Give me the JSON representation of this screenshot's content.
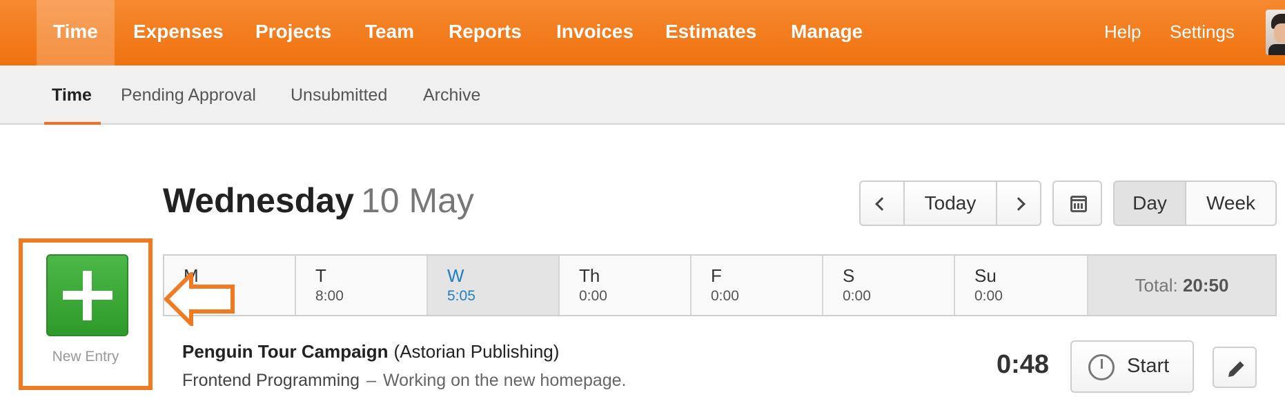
{
  "topnav": {
    "items": [
      "Time",
      "Expenses",
      "Projects",
      "Team",
      "Reports",
      "Invoices",
      "Estimates",
      "Manage"
    ],
    "right": [
      "Help",
      "Settings"
    ]
  },
  "subnav": {
    "tabs": [
      "Time",
      "Pending Approval",
      "Unsubmitted",
      "Archive"
    ]
  },
  "header": {
    "day_of_week": "Wednesday",
    "date": "10 May",
    "today_label": "Today",
    "view_day": "Day",
    "view_week": "Week"
  },
  "week": {
    "days": [
      {
        "label": "M",
        "hours": ""
      },
      {
        "label": "T",
        "hours": "8:00"
      },
      {
        "label": "W",
        "hours": "5:05"
      },
      {
        "label": "Th",
        "hours": "0:00"
      },
      {
        "label": "F",
        "hours": "0:00"
      },
      {
        "label": "S",
        "hours": "0:00"
      },
      {
        "label": "Su",
        "hours": "0:00"
      }
    ],
    "total_label": "Total:",
    "total_value": "20:50"
  },
  "new_entry": {
    "label": "New Entry"
  },
  "entry": {
    "project": "Penguin Tour Campaign",
    "client": "(Astorian Publishing)",
    "task": "Frontend Programming",
    "separator": "–",
    "notes": "Working on the new homepage.",
    "duration": "0:48",
    "start_label": "Start"
  },
  "colors": {
    "brand_orange": "#f36c21",
    "active_blue": "#1f7ec6",
    "new_entry_green": "#3aa836"
  }
}
